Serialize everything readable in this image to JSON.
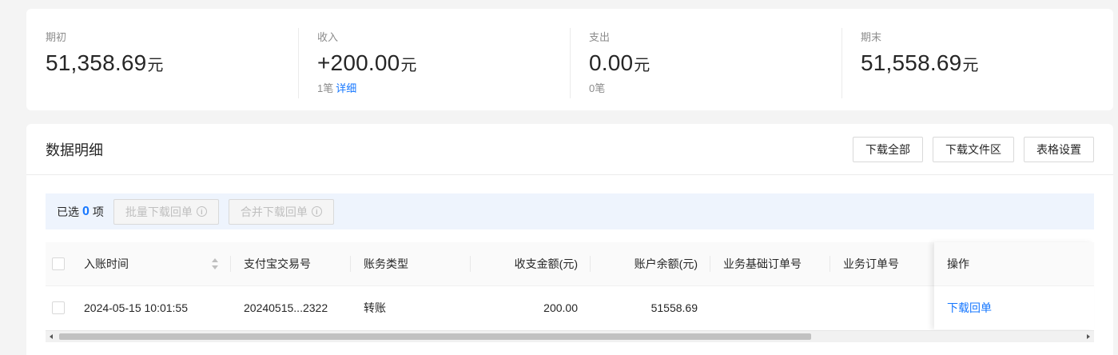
{
  "summary": {
    "opening": {
      "label": "期初",
      "amount": "51,358.69",
      "unit": "元"
    },
    "income": {
      "label": "收入",
      "amount": "+200.00",
      "unit": "元",
      "count": "1笔",
      "detail_link": "详细"
    },
    "expense": {
      "label": "支出",
      "amount": "0.00",
      "unit": "元",
      "count": "0笔"
    },
    "closing": {
      "label": "期末",
      "amount": "51,558.69",
      "unit": "元"
    }
  },
  "detail": {
    "title": "数据明细",
    "buttons": {
      "download_all": "下载全部",
      "download_area": "下载文件区",
      "table_settings": "表格设置"
    }
  },
  "selection": {
    "prefix": "已选",
    "count": "0",
    "suffix": "项",
    "batch_download": "批量下载回单",
    "merge_download": "合并下载回单"
  },
  "table": {
    "columns": [
      "入账时间",
      "支付宝交易号",
      "账务类型",
      "收支金额(元)",
      "账户余额(元)",
      "业务基础订单号",
      "业务订单号",
      "操作"
    ],
    "rows": [
      {
        "time": "2024-05-15 10:01:55",
        "trade_no": "20240515...2322",
        "type": "转账",
        "amount": "200.00",
        "balance": "51558.69",
        "base_order": "",
        "order": "",
        "action": "下载回单"
      }
    ]
  },
  "icons": {
    "info": "info-icon",
    "sort": "sort-icon"
  },
  "colors": {
    "accent": "#1677ff",
    "selection_bg": "#eef4fd"
  }
}
